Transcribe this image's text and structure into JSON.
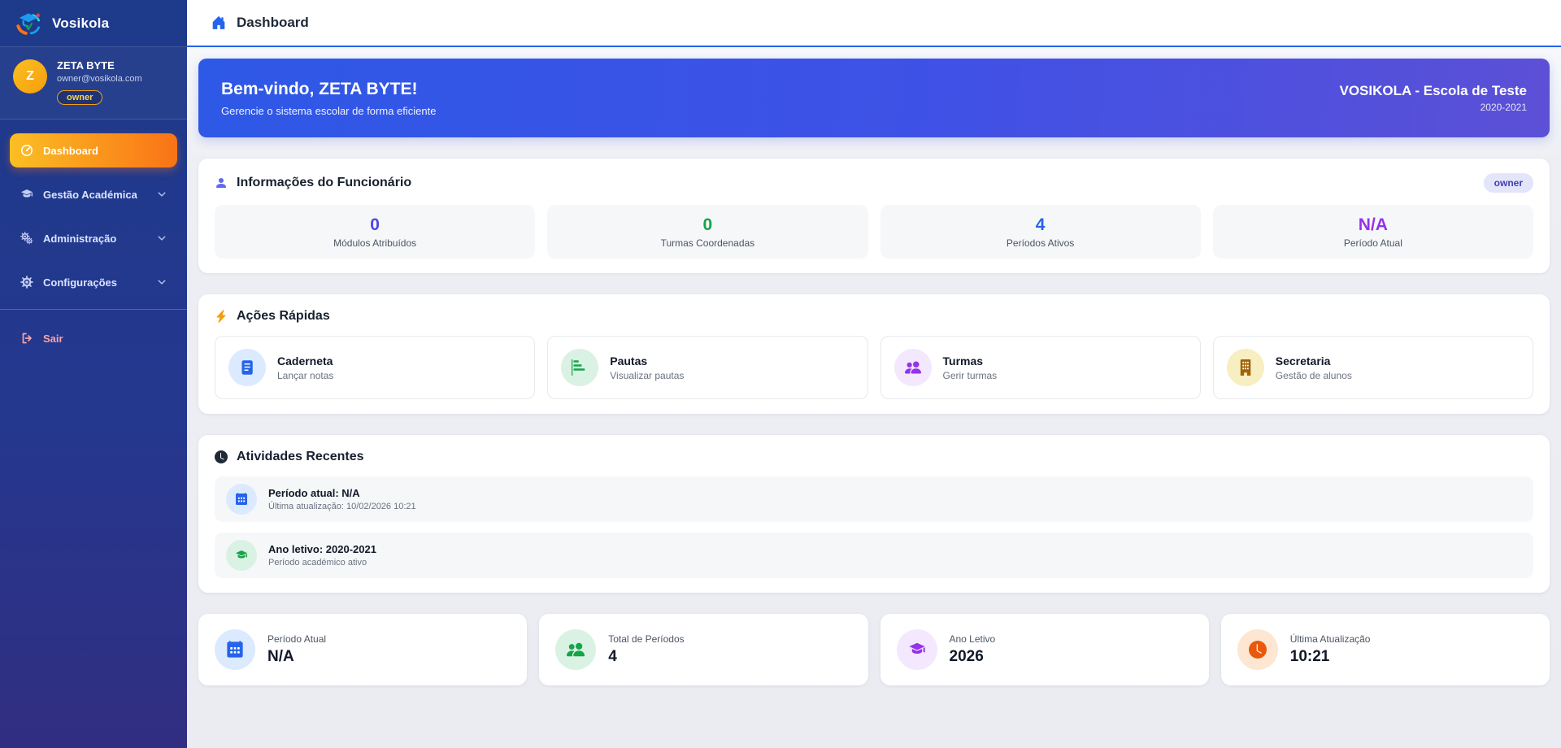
{
  "app": {
    "name": "Vosikola"
  },
  "sidebar": {
    "user": {
      "initial": "Z",
      "name": "ZETA BYTE",
      "email": "owner@vosikola.com",
      "role": "owner"
    },
    "menu": [
      {
        "label": "Dashboard",
        "icon": "gauge-icon",
        "active": true
      },
      {
        "label": "Gestão Académica",
        "icon": "graduation-cap-icon",
        "expandable": true
      },
      {
        "label": "Administração",
        "icon": "gears-icon",
        "expandable": true
      },
      {
        "label": "Configurações",
        "icon": "gear-icon",
        "expandable": true
      }
    ],
    "logout": {
      "label": "Sair",
      "icon": "logout-icon"
    }
  },
  "header": {
    "title": "Dashboard",
    "icon": "home-icon"
  },
  "banner": {
    "title": "Bem-vindo, ZETA BYTE!",
    "subtitle": "Gerencie o sistema escolar de forma eficiente",
    "school": "VOSIKOLA - Escola de Teste",
    "year": "2020-2021"
  },
  "employee_info": {
    "title": "Informações do Funcionário",
    "icon": "person-icon",
    "badge": "owner",
    "stats": [
      {
        "value": "0",
        "label": "Módulos Atribuídos",
        "color": "#4f46e5"
      },
      {
        "value": "0",
        "label": "Turmas Coordenadas",
        "color": "#16a34a"
      },
      {
        "value": "4",
        "label": "Períodos Ativos",
        "color": "#2563eb"
      },
      {
        "value": "N/A",
        "label": "Período Atual",
        "color": "#9333ea"
      }
    ]
  },
  "quick_actions": {
    "title": "Ações Rápidas",
    "icon": "lightning-icon",
    "items": [
      {
        "title": "Caderneta",
        "subtitle": "Lançar notas",
        "icon": "notebook-icon",
        "color": "#2563eb"
      },
      {
        "title": "Pautas",
        "subtitle": "Visualizar pautas",
        "icon": "chart-steps-icon",
        "color": "#16a34a"
      },
      {
        "title": "Turmas",
        "subtitle": "Gerir turmas",
        "icon": "people-icon",
        "color": "#9333ea"
      },
      {
        "title": "Secretaria",
        "subtitle": "Gestão de alunos",
        "icon": "building-icon",
        "color": "#a16207"
      }
    ]
  },
  "recent_activities": {
    "title": "Atividades Recentes",
    "icon": "clock-icon",
    "items": [
      {
        "title": "Período atual: N/A",
        "subtitle": "Última atualização: 10/02/2026 10:21",
        "icon": "calendar-icon",
        "color": "#2563eb"
      },
      {
        "title": "Ano letivo: 2020-2021",
        "subtitle": "Período académico ativo",
        "icon": "graduation-cap-icon",
        "color": "#16a34a"
      }
    ]
  },
  "summary_cards": [
    {
      "label": "Período Atual",
      "value": "N/A",
      "icon": "calendar-icon",
      "color": "#2563eb"
    },
    {
      "label": "Total de Períodos",
      "value": "4",
      "icon": "people-icon",
      "color": "#16a34a"
    },
    {
      "label": "Ano Letivo",
      "value": "2026",
      "icon": "graduation-cap-icon",
      "color": "#9333ea"
    },
    {
      "label": "Última Atualização",
      "value": "10:21",
      "icon": "clock-icon",
      "color": "#ea580c"
    }
  ],
  "colors": {
    "sidebar_top": "#1e3a8a",
    "sidebar_bottom": "#312e81",
    "active_menu_from": "#fbbf24",
    "active_menu_to": "#f97316",
    "banner_from": "#2e58e6",
    "banner_to": "#5c50d6",
    "header_accent": "#2563eb",
    "logout_text": "#fda4a4"
  }
}
